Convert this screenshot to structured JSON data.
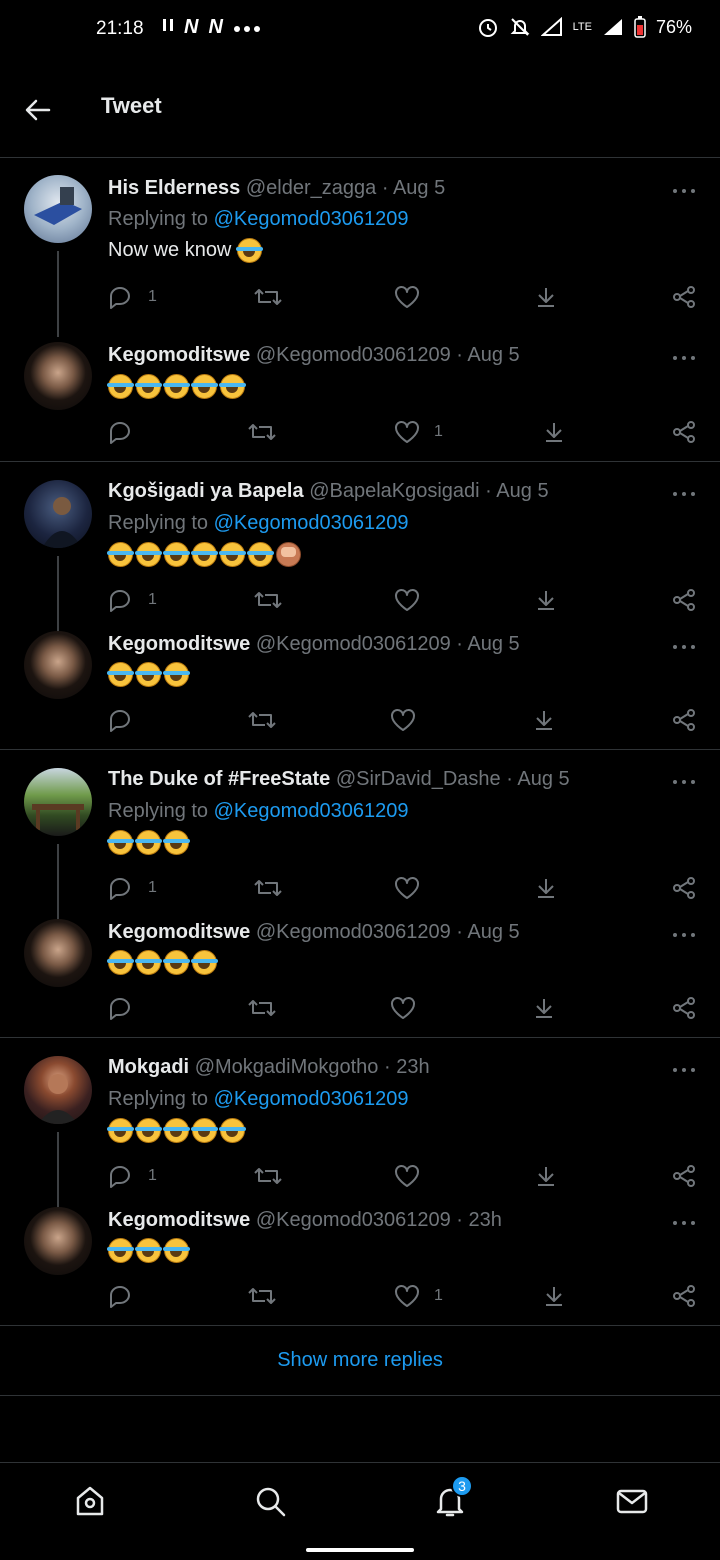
{
  "status_bar": {
    "time": "21:18",
    "left_icons": [
      "pause-icon",
      "netflix-icon",
      "netflix-icon",
      "more-dots-icon"
    ],
    "battery": "76%",
    "network": "LTE"
  },
  "header": {
    "title": "Tweet"
  },
  "threads": [
    {
      "reply": {
        "name": "His Elderness",
        "handle": "@elder_zagga",
        "date": "Aug 5",
        "replying_prefix": "Replying to ",
        "replying_to": "@Kegomod03061209",
        "text": "Now we know",
        "emojis": [
          "joy"
        ],
        "reply_count": "1",
        "like_count": ""
      },
      "response": {
        "name": "Kegomoditswe",
        "handle": "@Kegomod03061209",
        "date": "Aug 5",
        "emojis": [
          "rofl",
          "rofl",
          "rofl",
          "rofl",
          "rofl"
        ],
        "reply_count": "",
        "like_count": "1"
      }
    },
    {
      "reply": {
        "name": "Kgošigadi ya Bapela",
        "handle": "@BapelaKgosigadi",
        "date": "Aug 5",
        "replying_prefix": "Replying to ",
        "replying_to": "@Kegomod03061209",
        "emojis": [
          "rofl",
          "rofl",
          "rofl",
          "rofl",
          "rofl",
          "rofl",
          "see-no-evil"
        ],
        "reply_count": "1",
        "like_count": ""
      },
      "response": {
        "name": "Kegomoditswe",
        "handle": "@Kegomod03061209",
        "date": "Aug 5",
        "emojis": [
          "rofl",
          "rofl",
          "rofl"
        ],
        "reply_count": "",
        "like_count": ""
      }
    },
    {
      "reply": {
        "name": "The Duke of #FreeState",
        "handle": "@SirDavid_Dashe",
        "date": "Aug 5",
        "replying_prefix": "Replying to ",
        "replying_to": "@Kegomod03061209",
        "emojis": [
          "joy",
          "joy",
          "joy"
        ],
        "reply_count": "1",
        "like_count": ""
      },
      "response": {
        "name": "Kegomoditswe",
        "handle": "@Kegomod03061209",
        "date": "Aug 5",
        "emojis": [
          "rofl",
          "rofl",
          "rofl",
          "rofl"
        ],
        "reply_count": "",
        "like_count": ""
      }
    },
    {
      "reply": {
        "name": "Mokgadi",
        "handle": "@MokgadiMokgotho",
        "date": "23h",
        "replying_prefix": "Replying to ",
        "replying_to": "@Kegomod03061209",
        "emojis": [
          "rofl",
          "rofl",
          "rofl",
          "rofl",
          "rofl"
        ],
        "reply_count": "1",
        "like_count": ""
      },
      "response": {
        "name": "Kegomoditswe",
        "handle": "@Kegomod03061209",
        "date": "23h",
        "emojis": [
          "rofl",
          "rofl",
          "rofl"
        ],
        "reply_count": "",
        "like_count": "1"
      }
    }
  ],
  "show_more": "Show more replies",
  "bottom_nav": {
    "items": [
      "home-icon",
      "search-icon",
      "notifications-icon",
      "messages-icon"
    ],
    "notification_badge": "3"
  },
  "colors": {
    "accent": "#1d9bf0",
    "background": "#000000",
    "muted": "#71767b"
  }
}
